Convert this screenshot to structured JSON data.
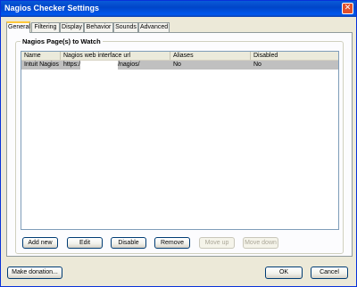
{
  "window": {
    "title": "Nagios Checker Settings",
    "close_glyph": "✕"
  },
  "tabs": [
    {
      "label": "General",
      "active": true
    },
    {
      "label": "Filtering",
      "active": false
    },
    {
      "label": "Display",
      "active": false
    },
    {
      "label": "Behavior",
      "active": false
    },
    {
      "label": "Sounds",
      "active": false
    },
    {
      "label": "Advanced",
      "active": false
    }
  ],
  "group": {
    "label": "Nagios Page(s) to Watch"
  },
  "list": {
    "columns": [
      "Name",
      "Nagios web interface url",
      "Aliases",
      "Disabled"
    ],
    "rows": [
      {
        "name": "Intuit Nagios",
        "url_prefix": "https:/",
        "url_suffix": "/nagios/",
        "aliases": "No",
        "disabled": "No"
      }
    ]
  },
  "actions": {
    "add": "Add new",
    "edit": "Edit",
    "disable": "Disable",
    "remove": "Remove",
    "move_up": "Move up",
    "move_down": "Move down"
  },
  "footer": {
    "donation": "Make donation...",
    "ok": "OK",
    "cancel": "Cancel"
  },
  "colors": {
    "title_bar": "#0058ee",
    "selected_row": "#c0c0c0",
    "dialog_bg": "#ece9d8"
  }
}
